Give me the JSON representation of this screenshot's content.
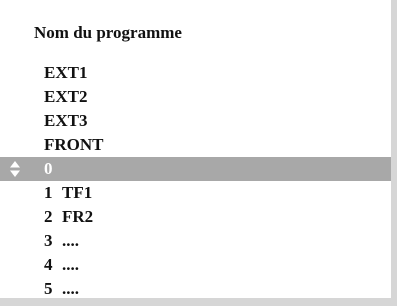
{
  "menu": {
    "title": "Nom du programme",
    "selected_index": 4,
    "updown_icon": "up-down-arrows-icon",
    "items": [
      {
        "num": "",
        "name": "EXT1"
      },
      {
        "num": "",
        "name": "EXT2"
      },
      {
        "num": "",
        "name": "EXT3"
      },
      {
        "num": "",
        "name": "FRONT"
      },
      {
        "num": "0",
        "name": ""
      },
      {
        "num": "1",
        "name": "TF1"
      },
      {
        "num": "2",
        "name": "FR2"
      },
      {
        "num": "3",
        "name": "...."
      },
      {
        "num": "4",
        "name": "...."
      },
      {
        "num": "5",
        "name": "...."
      }
    ]
  },
  "colors": {
    "highlight_bar": "#a8a8a8",
    "highlight_text": "#ffffff",
    "text": "#111111",
    "frame_shadow": "#d6d6d6"
  }
}
